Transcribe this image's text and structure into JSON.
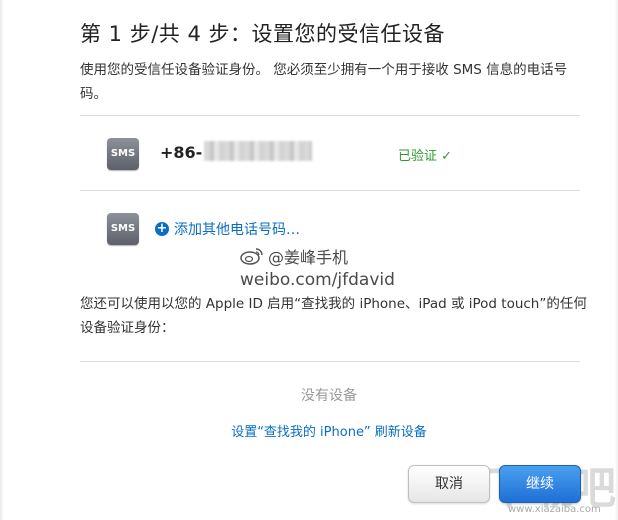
{
  "page": {
    "title": "第 1 步/共 4 步：设置您的受信任设备",
    "description": "使用您的受信任设备验证身份。 您必须至少拥有一个用于接收 SMS 信息的电话号码。"
  },
  "sms_list": {
    "badge_label": "SMS",
    "phone_prefix": "+86-",
    "verified_label": "已验证",
    "verified_check": "✓",
    "add_label": "添加其他电话号码…"
  },
  "watermark": {
    "line1": "@姜峰手机",
    "line2": "weibo.com/jfdavid"
  },
  "other_devices": {
    "text": "您还可以使用以您的 Apple ID 启用“查找我的 iPhone、iPad 或 iPod touch”的任何设备验证身份：",
    "no_devices": "没有设备",
    "setup_link": "设置“查找我的 iPhone” 刷新设备"
  },
  "buttons": {
    "cancel": "取消",
    "continue": "继续"
  },
  "site_watermark": {
    "big": "下载吧",
    "url": "www.xiazaiba.com"
  }
}
